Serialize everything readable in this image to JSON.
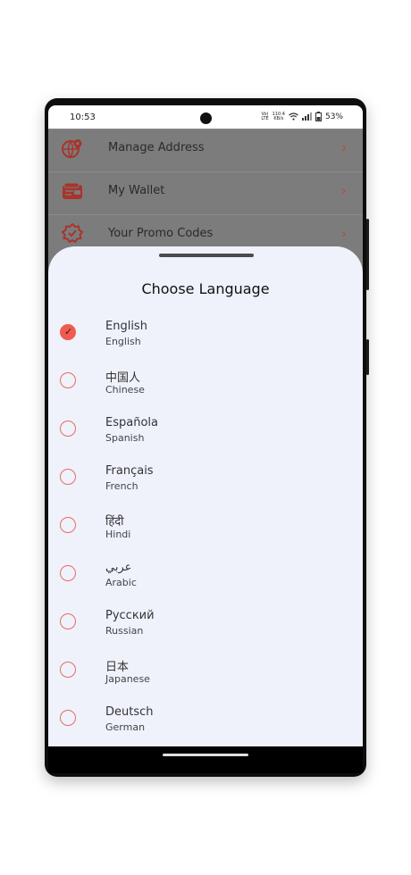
{
  "status_bar": {
    "time": "10:53",
    "network_top": "Vo)",
    "network_bottom": "LTE",
    "speed_top": "110.4",
    "speed_bottom": "KB/s",
    "battery": "53%"
  },
  "background_menu": {
    "items": [
      {
        "label": "Manage Address",
        "icon": "globe-pin-icon"
      },
      {
        "label": "My Wallet",
        "icon": "wallet-icon"
      },
      {
        "label": "Your Promo Codes",
        "icon": "badge-icon"
      }
    ],
    "chevron": "›"
  },
  "sheet": {
    "title": "Choose Language",
    "languages": [
      {
        "native": "English",
        "english": "English",
        "selected": true
      },
      {
        "native": "中国人",
        "english": "Chinese",
        "selected": false
      },
      {
        "native": "Española",
        "english": "Spanish",
        "selected": false
      },
      {
        "native": "Français",
        "english": "French",
        "selected": false
      },
      {
        "native": "हिंदी",
        "english": "Hindi",
        "selected": false
      },
      {
        "native": "عربي",
        "english": "Arabic",
        "selected": false
      },
      {
        "native": "Русский",
        "english": "Russian",
        "selected": false
      },
      {
        "native": "日本",
        "english": "Japanese",
        "selected": false
      },
      {
        "native": "Deutsch",
        "english": "German",
        "selected": false
      }
    ]
  },
  "colors": {
    "accent": "#f15a4f",
    "sheet_bg": "#eff2fb"
  }
}
